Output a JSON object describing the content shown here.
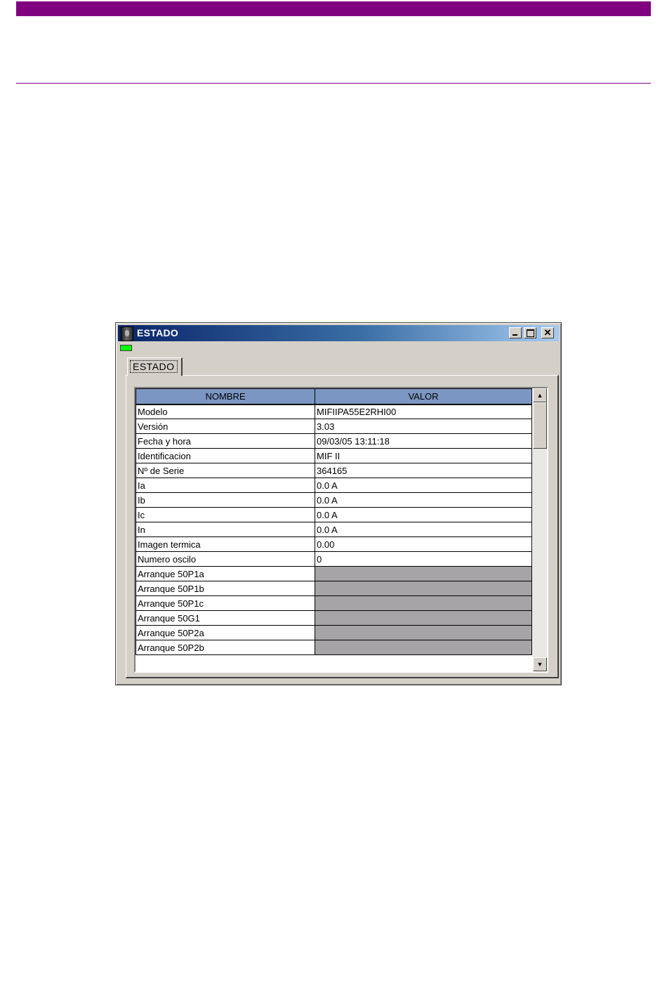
{
  "window": {
    "title": "ESTADO",
    "controls": {
      "minimize": "",
      "maximize": "",
      "close": "✕"
    }
  },
  "status_indicator": {
    "color": "#00ff00"
  },
  "tabs": [
    {
      "label": "ESTADO",
      "selected": true
    }
  ],
  "table": {
    "columns": [
      "NOMBRE",
      "VALOR"
    ],
    "rows": [
      {
        "name": "Modelo",
        "value": "MIFIIPA55E2RHI00"
      },
      {
        "name": "Versión",
        "value": "3.03"
      },
      {
        "name": "Fecha y hora",
        "value": "09/03/05 13:11:18"
      },
      {
        "name": "Identificacion",
        "value": "MIF II"
      },
      {
        "name": "Nº de Serie",
        "value": "364165"
      },
      {
        "name": "Ia",
        "value": "0.0 A"
      },
      {
        "name": "Ib",
        "value": "0.0 A"
      },
      {
        "name": "Ic",
        "value": "0.0 A"
      },
      {
        "name": "In",
        "value": "0.0 A"
      },
      {
        "name": "Imagen termica",
        "value": "0.00"
      },
      {
        "name": "Numero oscilo",
        "value": "0"
      },
      {
        "name": "Arranque 50P1a",
        "value": ""
      },
      {
        "name": "Arranque 50P1b",
        "value": ""
      },
      {
        "name": "Arranque 50P1c",
        "value": ""
      },
      {
        "name": "Arranque 50G1",
        "value": ""
      },
      {
        "name": "Arranque 50P2a",
        "value": ""
      },
      {
        "name": "Arranque 50P2b",
        "value": ""
      }
    ]
  },
  "scrollbar": {
    "up_arrow": "▲",
    "down_arrow": "▼"
  },
  "colors": {
    "header_bar": "#800080",
    "column_header": "#7b96c2",
    "inactive_cell": "#a6a4a6"
  }
}
